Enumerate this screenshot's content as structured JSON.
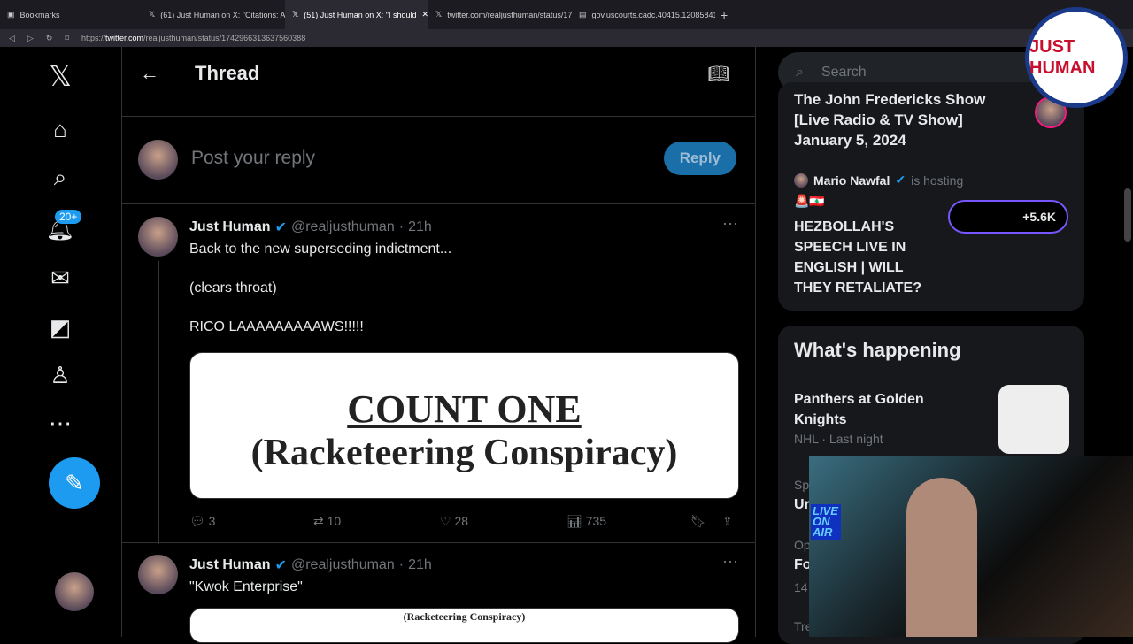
{
  "browser": {
    "tabs": [
      {
        "label": "Bookmarks"
      },
      {
        "label": "(61) Just Human on X: \"Citations: Atlan"
      },
      {
        "label": "(51) Just Human on X: \"I should"
      },
      {
        "label": "twitter.com/realjusthuman/status/174"
      },
      {
        "label": "gov.uscourts.cadc.40415.1208584119"
      }
    ],
    "url_prefix": "https://",
    "url_domain": "twitter.com",
    "url_path": "/realjusthuman/status/1742966313637560388"
  },
  "nav": {
    "badge": "20+"
  },
  "header": {
    "title": "Thread"
  },
  "reply": {
    "placeholder": "Post your reply",
    "button": "Reply"
  },
  "tweets": [
    {
      "name": "Just Human",
      "handle": "@realjusthuman",
      "time": "21h",
      "lines": [
        "Back to the new superseding indictment...",
        "(clears throat)",
        "RICO LAAAAAAAAAWS!!!!!"
      ],
      "media_title": "COUNT ONE",
      "media_subtitle": "(Racketeering Conspiracy)",
      "replies": "3",
      "reposts": "10",
      "likes": "28",
      "views": "735"
    },
    {
      "name": "Just Human",
      "handle": "@realjusthuman",
      "time": "21h",
      "lines": [
        "\"Kwok Enterprise\""
      ],
      "media_subtitle": "(Racketeering Conspiracy)"
    }
  ],
  "sidebar": {
    "search_placeholder": "Search",
    "spaces": {
      "title1": "The John Fredericks Show [Live Radio & TV Show] January 5, 2024",
      "host": "Mario Nawfal",
      "hosting": "is hosting",
      "title2": "HEZBOLLAH'S SPEECH LIVE IN ENGLISH | WILL THEY RETALIATE?",
      "listeners": "+5.6K"
    },
    "happening": {
      "title": "What's happening",
      "items": [
        {
          "title": "Panthers at Golden Knights",
          "meta": "NHL · Last night"
        },
        {
          "context": "Sp",
          "title": "Ur"
        },
        {
          "context": "Op",
          "title": "Fo",
          "meta": "14"
        },
        {
          "context": "Tre"
        }
      ]
    }
  },
  "overlay": {
    "logo_text": "JUST HUMAN",
    "webcam_sign": "LIVE ON AIR"
  }
}
